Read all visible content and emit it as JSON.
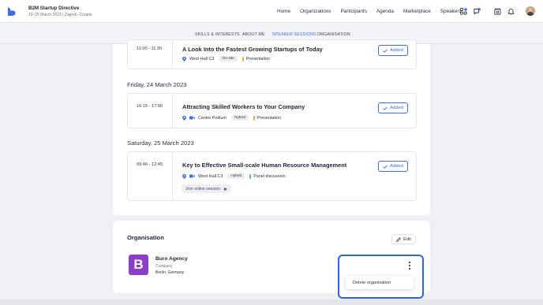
{
  "header": {
    "event_title": "B2M Startup Directive",
    "event_subtitle": "10–25 March 2023 | Zagreb, Croatia",
    "nav": [
      "Home",
      "Organizations",
      "Participants",
      "Agenda",
      "Marketplace",
      "Speakers"
    ],
    "icons": [
      "apps-icon",
      "chat-icon",
      "calendar-icon",
      "bell-icon"
    ],
    "accent_color": "#3a6ee8"
  },
  "tabs": [
    {
      "label": "SKILLS & INTERESTS",
      "active": false
    },
    {
      "label": "ABOUT ME",
      "active": false
    },
    {
      "label": "SPEAKER SESSIONS",
      "active": true
    },
    {
      "label": "ORGANISATION",
      "active": false
    }
  ],
  "sessions": [
    {
      "time": "11:00 - 11:30",
      "title": "A Look Into the Fastest Growing Startups of Today",
      "location": "West Hall C3",
      "mode": "On-site",
      "type": "Presentation",
      "type_color": "#f2a93b",
      "status": "Added"
    },
    {
      "day": "Friday, 24 March 2023",
      "time": "16:15 - 17:00",
      "title": "Attracting Skilled Workers to Your Company",
      "location": "Centre Podium",
      "mode": "Hybrid",
      "type": "Presentation",
      "type_color": "#f2a93b",
      "status": "Added"
    },
    {
      "day": "Saturday, 25 March 2023",
      "time": "09:40 - 12:45",
      "title": "Key to Effective Small-scale Human Resource Management",
      "location": "West Hall C3",
      "mode": "Hybrid",
      "type": "Panel discussion",
      "type_color": "#3db8c8",
      "status": "Added",
      "join_label": "Join online session"
    }
  ],
  "organisation": {
    "heading": "Organisation",
    "edit_label": "Edit",
    "logo_letter": "B",
    "name": "Buro Agency",
    "type": "Company",
    "location": "Berlin, Germany",
    "menu_item": "Delete organisation"
  }
}
